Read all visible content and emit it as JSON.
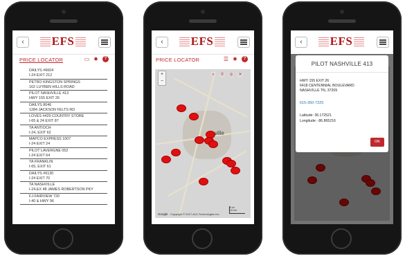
{
  "brand": {
    "logo_text": "EFS"
  },
  "nav": {
    "back_glyph": "‹"
  },
  "screen1": {
    "title": "PRICE LOCATOR",
    "icons": [
      "map-icon",
      "gear-icon",
      "help-icon"
    ],
    "help_glyph": "?",
    "stations": [
      {
        "name": "DAILYS #6604",
        "address": "I-24 EXIT 212"
      },
      {
        "name": "PETRO KINGSTON SPRINGS",
        "address": "162 LUYBEN HILLS ROAD"
      },
      {
        "name": "PILOT NASHVILLE 413",
        "address": "HWY 155 EXIT 26"
      },
      {
        "name": "DAILYS 8046",
        "address": "1284 JACKSON FELTS RD"
      },
      {
        "name": "LOVES #429 COUNTRY STORE",
        "address": "I-65 & 24 EXIT 87"
      },
      {
        "name": "TA ANTIOCH",
        "address": "I-24, EXIT 62"
      },
      {
        "name": "MAPCO EXPRESS 1007",
        "address": "I-24 EXIT 24"
      },
      {
        "name": "PILOT LAVERGNE 052",
        "address": "I-24 EXIT 64"
      },
      {
        "name": "TA FRANKLIN",
        "address": "I-65, EXIT 61"
      },
      {
        "name": "DAILYS #6130",
        "address": "I-24 EXIT 70"
      },
      {
        "name": "TA NASHVILLE",
        "address": "I-24,EX 48 JAMES ROBERTSON PKY"
      },
      {
        "name": "FJ-FAIRVIEW 720",
        "address": "I-40 & HWY 96"
      }
    ]
  },
  "screen2": {
    "title": "PRICE LOCATOR",
    "icons": [
      "list-icon",
      "gear-icon",
      "help-icon"
    ],
    "help_glyph": "?",
    "zoom_in": "+",
    "zoom_out": "−",
    "map_city_label": "ville",
    "map_footer_google": "Google",
    "map_copyright": "Copyright © 2017 ALK Technologies Inc.",
    "scale_miles": "5 mi",
    "scale_km": "10 km"
  },
  "screen3": {
    "modal_title": "PILOT NASHVILLE 413",
    "address_line1": "HWY 155 EXIT 26",
    "address_line2": "6418 CENTENNIAL BOULEVARD",
    "address_line3": "NASHVILLE TN, 37209",
    "phone": "615-350-7225",
    "latitude_text": "Latitude: 36.172521",
    "longitude_text": "Longitude: -86.865216",
    "ok_label": "OK"
  },
  "colors": {
    "accent": "#c0282d",
    "pin": "#e01010",
    "link": "#2a6fb0"
  }
}
